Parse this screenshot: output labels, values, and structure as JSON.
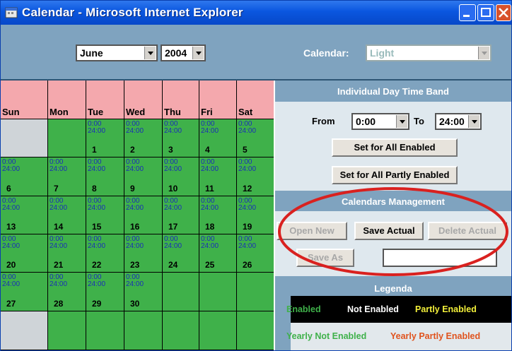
{
  "window": {
    "title": "Calendar - Microsoft Internet Explorer"
  },
  "toolbar": {
    "month": "June",
    "year": "2004",
    "calendar_label": "Calendar:",
    "calendar_value": "Light"
  },
  "calendar": {
    "weekdays": [
      "Sun",
      "Mon",
      "Tue",
      "Wed",
      "Thu",
      "Fri",
      "Sat"
    ],
    "time_band": [
      "0:00",
      "24:00"
    ],
    "weeks": [
      [
        null,
        null,
        1,
        2,
        3,
        4,
        5
      ],
      [
        6,
        7,
        8,
        9,
        10,
        11,
        12
      ],
      [
        13,
        14,
        15,
        16,
        17,
        18,
        19
      ],
      [
        20,
        21,
        22,
        23,
        24,
        25,
        26
      ],
      [
        27,
        28,
        29,
        30,
        null,
        null,
        null
      ],
      [
        null,
        null,
        null,
        null,
        null,
        null,
        null
      ]
    ]
  },
  "time_band_section": {
    "title": "Individual Day Time Band",
    "from_label": "From",
    "from_value": "0:00",
    "to_label": "To",
    "to_value": "24:00",
    "set_all_enabled": "Set for All Enabled",
    "set_all_partly": "Set for All Partly Enabled"
  },
  "management": {
    "title": "Calendars Management",
    "open_new": "Open New",
    "save_actual": "Save Actual",
    "delete_actual": "Delete Actual",
    "save_as": "Save As",
    "name_value": ""
  },
  "legend": {
    "title": "Legenda",
    "enabled": "Enabled",
    "not_enabled": "Not Enabled",
    "partly_enabled": "Partly Enabled",
    "yearly_not_enabled": "Yearly Not Enabled",
    "yearly_partly_enabled": "Yearly Partly Enabled",
    "colors": {
      "enabled": "#3fb14a",
      "not_enabled": "#ffffff",
      "partly_enabled": "#f2ef3a",
      "yearly_not_enabled": "#3fb14a",
      "yearly_partly_enabled": "#e0531e",
      "highlight_ellipse": "#d9211f"
    }
  }
}
